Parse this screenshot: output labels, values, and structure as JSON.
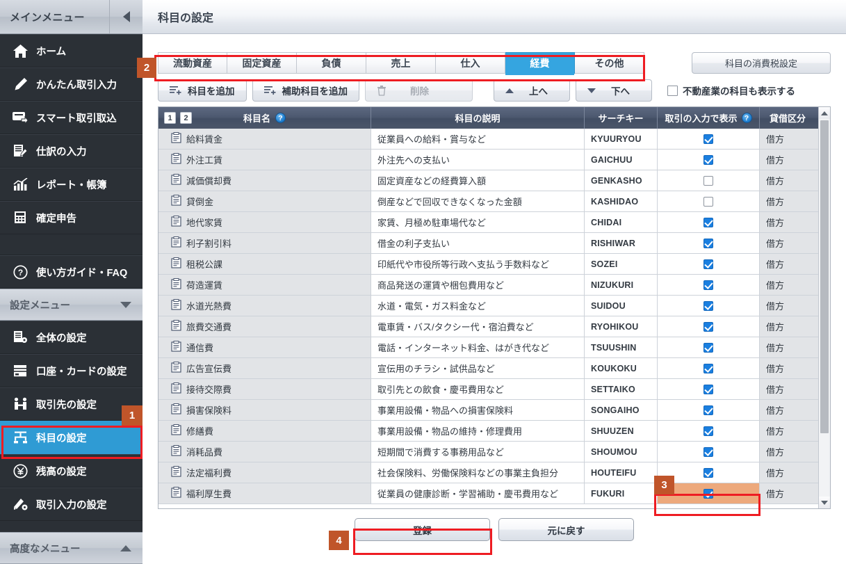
{
  "sidebar": {
    "menu_header": "メインメニュー",
    "collapse_icon": "triangle-left-icon",
    "items": [
      {
        "label": "ホーム",
        "icon": "home-icon"
      },
      {
        "label": "かんたん取引入力",
        "icon": "pencil-icon"
      },
      {
        "label": "スマート取引取込",
        "icon": "import-icon"
      },
      {
        "label": "仕訳の入力",
        "icon": "ledger-edit-icon"
      },
      {
        "label": "レポート・帳簿",
        "icon": "bar-chart-icon"
      },
      {
        "label": "確定申告",
        "icon": "tax-form-icon"
      }
    ],
    "faq": {
      "label": "使い方ガイド・FAQ",
      "icon": "question-circle-icon"
    },
    "settings_header": {
      "label": "設定メニュー",
      "icon": "triangle-down-icon"
    },
    "settings_items": [
      {
        "label": "全体の設定",
        "icon": "document-gear-icon",
        "active": false
      },
      {
        "label": "口座・カードの設定",
        "icon": "card-stack-icon",
        "active": false
      },
      {
        "label": "取引先の設定",
        "icon": "people-icon",
        "active": false
      },
      {
        "label": "科目の設定",
        "icon": "account-item-icon",
        "active": true
      },
      {
        "label": "残高の設定",
        "icon": "yen-circle-icon",
        "active": false
      },
      {
        "label": "取引入力の設定",
        "icon": "rocket-gear-icon",
        "active": false
      }
    ],
    "advanced_header": {
      "label": "高度なメニュー",
      "icon": "triangle-up-icon"
    }
  },
  "header": {
    "title": "科目の設定"
  },
  "tabs": [
    {
      "label": "流動資産",
      "selected": false
    },
    {
      "label": "固定資産",
      "selected": false
    },
    {
      "label": "負債",
      "selected": false
    },
    {
      "label": "売上",
      "selected": false
    },
    {
      "label": "仕入",
      "selected": false
    },
    {
      "label": "経費",
      "selected": true
    },
    {
      "label": "その他",
      "selected": false
    }
  ],
  "tax_setting_button": "科目の消費税設定",
  "toolbar": {
    "add_item": {
      "label": "科目を追加",
      "icon": "list-add-icon",
      "disabled": false
    },
    "add_sub_item": {
      "label": "補助科目を追加",
      "icon": "list-add-icon",
      "disabled": false
    },
    "delete": {
      "label": "削除",
      "icon": "trash-icon",
      "disabled": true
    },
    "move_up": {
      "label": "上へ",
      "icon": "triangle-up-icon"
    },
    "move_down": {
      "label": "下へ",
      "icon": "triangle-down-icon"
    },
    "realestate_checkbox": {
      "label": "不動産業の科目も表示する",
      "checked": false
    }
  },
  "table": {
    "header": {
      "level1_button": "1",
      "level2_button": "2",
      "col_name": "科目名",
      "col_name_help": "?",
      "col_desc": "科目の説明",
      "col_key": "サーチキー",
      "col_display": "取引の入力で表示",
      "col_display_help": "?",
      "col_kbn": "貸借区分"
    },
    "rows": [
      {
        "name": "給料賃金",
        "desc": "従業員への給料・賞与など",
        "key": "KYUURYOU",
        "checked": true,
        "kbn": "借方",
        "highlight": false
      },
      {
        "name": "外注工賃",
        "desc": "外注先への支払い",
        "key": "GAICHUU",
        "checked": true,
        "kbn": "借方",
        "highlight": false
      },
      {
        "name": "減価償却費",
        "desc": "固定資産などの経費算入額",
        "key": "GENKASHO",
        "checked": false,
        "kbn": "借方",
        "highlight": false
      },
      {
        "name": "貸倒金",
        "desc": "倒産などで回収できなくなった金額",
        "key": "KASHIDAO",
        "checked": false,
        "kbn": "借方",
        "highlight": false
      },
      {
        "name": "地代家賃",
        "desc": "家賃、月極め駐車場代など",
        "key": "CHIDAI",
        "checked": true,
        "kbn": "借方",
        "highlight": false
      },
      {
        "name": "利子割引料",
        "desc": "借金の利子支払い",
        "key": "RISHIWAR",
        "checked": true,
        "kbn": "借方",
        "highlight": false
      },
      {
        "name": "租税公課",
        "desc": "印紙代や市役所等行政へ支払う手数料など",
        "key": "SOZEI",
        "checked": true,
        "kbn": "借方",
        "highlight": false
      },
      {
        "name": "荷造運賃",
        "desc": "商品発送の運賃や梱包費用など",
        "key": "NIZUKURI",
        "checked": true,
        "kbn": "借方",
        "highlight": false
      },
      {
        "name": "水道光熱費",
        "desc": "水道・電気・ガス料金など",
        "key": "SUIDOU",
        "checked": true,
        "kbn": "借方",
        "highlight": false
      },
      {
        "name": "旅費交通費",
        "desc": "電車賃・バス/タクシー代・宿泊費など",
        "key": "RYOHIKOU",
        "checked": true,
        "kbn": "借方",
        "highlight": false
      },
      {
        "name": "通信費",
        "desc": "電話・インターネット料金、はがき代など",
        "key": "TSUUSHIN",
        "checked": true,
        "kbn": "借方",
        "highlight": false
      },
      {
        "name": "広告宣伝費",
        "desc": "宣伝用のチラシ・試供品など",
        "key": "KOUKOKU",
        "checked": true,
        "kbn": "借方",
        "highlight": false
      },
      {
        "name": "接待交際費",
        "desc": "取引先との飲食・慶弔費用など",
        "key": "SETTAIKO",
        "checked": true,
        "kbn": "借方",
        "highlight": false
      },
      {
        "name": "損害保険料",
        "desc": "事業用設備・物品への損害保険料",
        "key": "SONGAIHO",
        "checked": true,
        "kbn": "借方",
        "highlight": false
      },
      {
        "name": "修繕費",
        "desc": "事業用設備・物品の維持・修理費用",
        "key": "SHUUZEN",
        "checked": true,
        "kbn": "借方",
        "highlight": false
      },
      {
        "name": "消耗品費",
        "desc": "短期間で消費する事務用品など",
        "key": "SHOUMOU",
        "checked": true,
        "kbn": "借方",
        "highlight": false
      },
      {
        "name": "法定福利費",
        "desc": "社会保険料、労働保険料などの事業主負担分",
        "key": "HOUTEIFU",
        "checked": true,
        "kbn": "借方",
        "highlight": false
      },
      {
        "name": "福利厚生費",
        "desc": "従業員の健康診断・学習補助・慶弔費用など",
        "key": "FUKURI",
        "checked": true,
        "kbn": "借方",
        "highlight": true
      }
    ],
    "scrollbar": {
      "up_icon": "triangle-up-icon",
      "down_icon": "triangle-down-icon"
    }
  },
  "footer": {
    "register": "登録",
    "revert": "元に戻す"
  },
  "annotations": [
    {
      "id": "1",
      "target": "sidebar-item-科目の設定"
    },
    {
      "id": "2",
      "target": "tab-bar"
    },
    {
      "id": "3",
      "target": "row-福利厚生費-display-checkbox"
    },
    {
      "id": "4",
      "target": "register-button"
    }
  ],
  "colors": {
    "accent_blue": "#35a5e0",
    "annotation_red": "#ee1c22",
    "annotation_badge": "#c0552a",
    "highlight_orange": "#eda97c",
    "sidebar_bg": "#2b3036",
    "table_header": "#4d5970"
  }
}
